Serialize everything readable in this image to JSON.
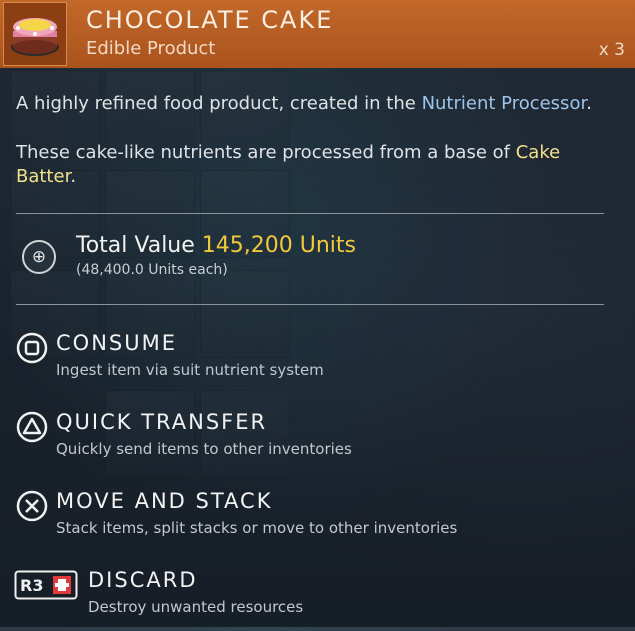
{
  "item": {
    "title": "CHOCOLATE CAKE",
    "type": "Edible Product",
    "quantity": "x 3",
    "icon": "chocolate-cake-icon"
  },
  "description": {
    "line1_prefix": "A highly refined food product, created in the ",
    "line1_link": "Nutrient Processor",
    "line1_suffix": ".",
    "line2_prefix": "These cake-like nutrients are processed from a base of ",
    "line2_link": "Cake Batter",
    "line2_suffix": "."
  },
  "value": {
    "label": "Total Value",
    "amount": "145,200 Units",
    "each": "(48,400.0 Units each)",
    "icon": "units-icon"
  },
  "actions": [
    {
      "title": "CONSUME",
      "desc": "Ingest item via suit nutrient system",
      "icon": "square-button-icon"
    },
    {
      "title": "QUICK TRANSFER",
      "desc": "Quickly send items to other inventories",
      "icon": "triangle-button-icon"
    },
    {
      "title": "MOVE AND STACK",
      "desc": "Stack items, split stacks or move to other inventories",
      "icon": "cross-button-icon"
    },
    {
      "title": "DISCARD",
      "desc": "Destroy unwanted resources",
      "icon": "r3-button-icon",
      "button_label": "R3"
    }
  ],
  "colors": {
    "header": "#b85e22",
    "highlight_blue": "#9ec4ea",
    "highlight_yellow": "#f2e08c",
    "units_gold": "#f2c93d"
  }
}
